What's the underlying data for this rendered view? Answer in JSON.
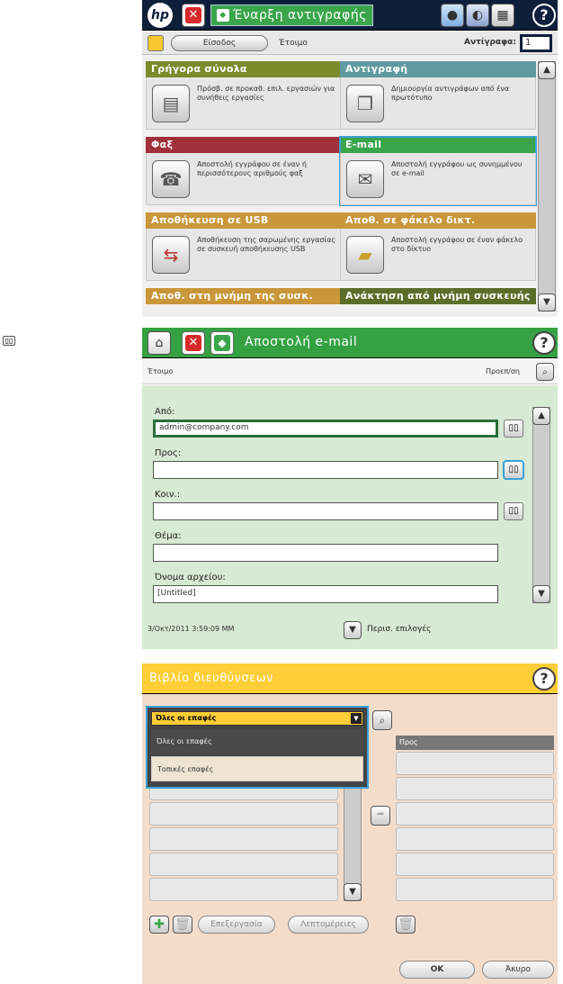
{
  "copy_screen": {
    "logo": "hp",
    "start_label": "Έναρξη αντιγραφής",
    "signin_label": "Είσοδος",
    "status": "Έτοιμο",
    "copies_label": "Αντίγραφα:",
    "copies_value": "1",
    "tiles": [
      {
        "title": "Γρήγορα σύνολα",
        "desc": "Πρόσβ. σε προκαθ. επιλ. εργασιών για συνήθεις εργασίες",
        "color": "#7a8c2a",
        "icon": "clipboard-icon"
      },
      {
        "title": "Αντιγραφή",
        "desc": "Δημιουργία αντιγράφων από ένα πρωτότυπο",
        "color": "#5f9aa0",
        "icon": "copy-icon"
      },
      {
        "title": "Φαξ",
        "desc": "Αποστολή εγγράφου σε έναν ή περισσότερους αριθμούς φαξ",
        "color": "#a1303a",
        "icon": "fax-icon"
      },
      {
        "title": "E-mail",
        "desc": "Αποστολή εγγράφου ως συνημμένου σε e-mail",
        "color": "#3aa54a",
        "icon": "envelope-icon"
      },
      {
        "title": "Αποθήκευση σε USB",
        "desc": "Αποθήκευση της σαρωμένης εργασίας σε συσκευή αποθήκευσης USB",
        "color": "#c9963a",
        "icon": "usb-icon"
      },
      {
        "title": "Αποθ. σε φάκελο δικτ.",
        "desc": "Αποστολή εγγράφου σε έναν φάκελο στο δίκτυο",
        "color": "#c9963a",
        "icon": "folder-icon"
      }
    ],
    "bottom_left": "Αποθ. στη μνήμη της συσκ.",
    "bottom_right": "Ανάκτηση από μνήμη συσκευής"
  },
  "email_screen": {
    "title": "Αποστολή e-mail",
    "status": "Έτοιμο",
    "preview": "Προεπ/ση",
    "from_label": "Από:",
    "from_value": "admin@company.com",
    "to_label": "Προς:",
    "cc_label": "Κοιν.:",
    "subject_label": "Θέμα:",
    "filename_label": "Όνομα αρχείου:",
    "filename_value": "[Untitled]",
    "timestamp": "3/Οκτ/2011 3:59:09 MM",
    "more_options": "Περισ. επιλογές"
  },
  "address_book": {
    "title": "Βιβλίο διευθύνσεων",
    "selected": "Όλες οι επαφές",
    "options": [
      "Όλες οι επαφές",
      "Τοπικές επαφές"
    ],
    "to_header": "Προς",
    "edit_label": "Επεξεργασία",
    "details_label": "Λεπτομέρειες",
    "ok_label": "OK",
    "cancel_label": "Άκυρο"
  }
}
